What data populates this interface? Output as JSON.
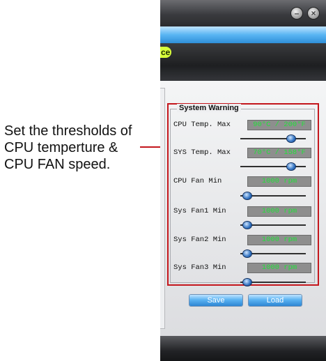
{
  "annotation": {
    "lines": [
      "Set the thresholds of",
      "CPU temperture &",
      "CPU FAN speed."
    ]
  },
  "window": {
    "tab_fragment_text": "ce",
    "min_symbol": "–",
    "close_symbol": "×"
  },
  "system_warning": {
    "title": "System Warning",
    "rows": [
      {
        "label": "CPU Temp. Max",
        "value": "90°C / 200°F",
        "slider_fraction": 0.82
      },
      {
        "label": "SYS Temp. Max",
        "value": "70°C / 158°F",
        "slider_fraction": 0.82
      },
      {
        "label": "CPU Fan Min",
        "value": "1000 rpm",
        "slider_fraction": 0.05
      },
      {
        "label": "Sys Fan1 Min",
        "value": "1000 rpm",
        "slider_fraction": 0.05
      },
      {
        "label": "Sys Fan2 Min",
        "value": "1000 rpm",
        "slider_fraction": 0.05
      },
      {
        "label": "Sys Fan3 Min",
        "value": "1000 rpm",
        "slider_fraction": 0.05
      }
    ],
    "buttons": {
      "save": "Save",
      "load": "Load"
    }
  },
  "colors": {
    "highlight": "#c4161c",
    "value_text": "#22e03a",
    "accent_tab": "#d8ff3a"
  }
}
